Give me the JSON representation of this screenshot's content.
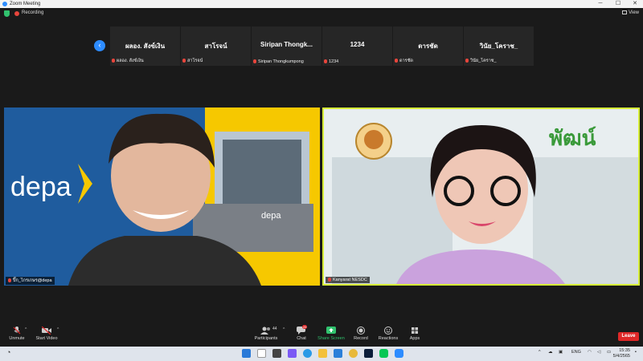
{
  "window": {
    "title": "Zoom Meeting"
  },
  "top_bar": {
    "recording_label": "Recording",
    "view_label": "View"
  },
  "gallery": [
    {
      "display_name": "ผลอง. สังข์เงิน",
      "label": "ผลอง. สังข์เงิน",
      "muted": true
    },
    {
      "display_name": "สาโรจน์",
      "label": "สาโรจน์",
      "muted": true
    },
    {
      "display_name": "Siripan Thongk...",
      "label": "Siripan Thongkumpong",
      "muted": true
    },
    {
      "display_name": "1234",
      "label": "1234",
      "muted": true
    },
    {
      "display_name": "ดารชัด",
      "label": "ดารชัด",
      "muted": true
    },
    {
      "display_name": "วินัย_โคราช_",
      "label": "วินัย_โคราช_",
      "muted": true
    }
  ],
  "videos": {
    "left": {
      "label": "ปิ๊ก_ไกรเกษร@depa",
      "muted": true
    },
    "right": {
      "label": "Kanyarat NESDC",
      "muted": true
    }
  },
  "toolbar": {
    "unmute": "Unmute",
    "start_video": "Start Video",
    "participants": "Participants",
    "participants_count": "44",
    "chat": "Chat",
    "chat_badge": "26",
    "share_screen": "Share Screen",
    "record": "Record",
    "reactions": "Reactions",
    "apps": "Apps",
    "leave": "Leave"
  },
  "taskbar": {
    "language": "ENG",
    "time": "15:35",
    "date": "5/4/2565"
  },
  "colors": {
    "zoom_blue": "#2d8cff",
    "active_speaker": "#d6ed37",
    "leave_red": "#e02828",
    "share_green": "#31c26e"
  }
}
